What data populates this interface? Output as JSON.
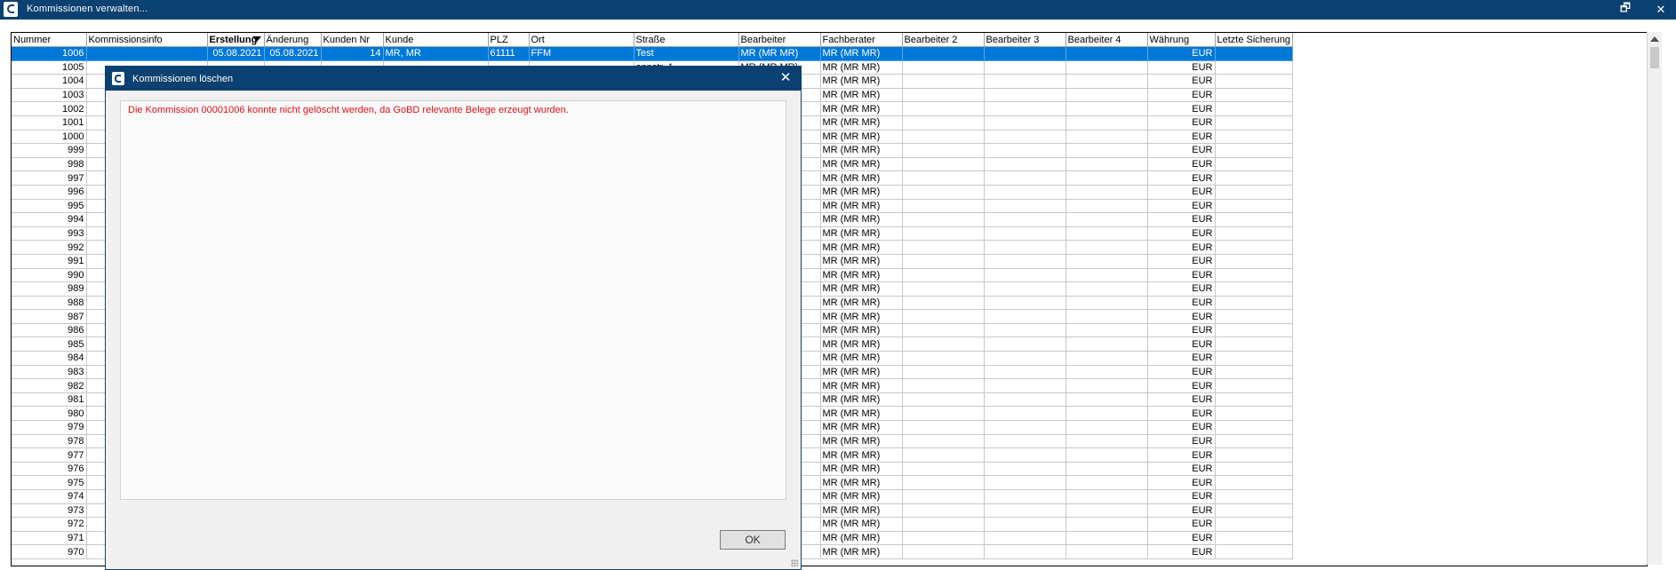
{
  "window": {
    "title": "Kommissionen verwalten...",
    "restore_glyph": "🗗",
    "close_glyph": "✕"
  },
  "grid": {
    "columns": [
      {
        "key": "nummer",
        "label": "Nummer",
        "width": 100,
        "align": "r"
      },
      {
        "key": "info",
        "label": "Kommissionsinfo",
        "width": 170,
        "align": ""
      },
      {
        "key": "erstellung",
        "label": "Erstellung",
        "width": 76,
        "align": "r",
        "sorted": true
      },
      {
        "key": "aenderung",
        "label": "Änderung",
        "width": 76,
        "align": "r"
      },
      {
        "key": "kundennr",
        "label": "Kunden Nr",
        "width": 85,
        "align": "r"
      },
      {
        "key": "kunde",
        "label": "Kunde",
        "width": 142,
        "align": ""
      },
      {
        "key": "plz",
        "label": "PLZ",
        "width": 55,
        "align": ""
      },
      {
        "key": "ort",
        "label": "Ort",
        "width": 143,
        "align": ""
      },
      {
        "key": "strasse",
        "label": "Straße",
        "width": 143,
        "align": ""
      },
      {
        "key": "bearbeiter",
        "label": "Bearbeiter",
        "width": 112,
        "align": ""
      },
      {
        "key": "fachberater",
        "label": "Fachberater",
        "width": 112,
        "align": ""
      },
      {
        "key": "bearbeiter2",
        "label": "Bearbeiter 2",
        "width": 112,
        "align": ""
      },
      {
        "key": "bearbeiter3",
        "label": "Bearbeiter 3",
        "width": 112,
        "align": ""
      },
      {
        "key": "bearbeiter4",
        "label": "Bearbeiter 4",
        "width": 112,
        "align": ""
      },
      {
        "key": "waehrung",
        "label": "Währung",
        "width": 92,
        "align": "r"
      },
      {
        "key": "sicherung",
        "label": "Letzte Sicherung",
        "width": 100,
        "align": ""
      }
    ],
    "rows": [
      {
        "nummer": "1006",
        "info": "",
        "erstellung": "05.08.2021",
        "aenderung": "05.08.2021",
        "kundennr": "14",
        "kunde": "MR, MR",
        "plz": "61111",
        "ort": "FFM",
        "strasse": "Test",
        "bearbeiter": "MR (MR MR)",
        "fachberater": "MR (MR MR)",
        "bearbeiter2": "",
        "bearbeiter3": "",
        "bearbeiter4": "",
        "waehrung": "EUR",
        "sicherung": "",
        "selected": true
      },
      {
        "nummer": "1005",
        "strasse": "annstr. 1",
        "bearbeiter": "MR (MR MR)",
        "fachberater": "MR (MR MR)",
        "waehrung": "EUR"
      },
      {
        "nummer": "1004",
        "bearbeiter": "MR (MR MR)",
        "fachberater": "MR (MR MR)",
        "waehrung": "EUR"
      },
      {
        "nummer": "1003",
        "bearbeiter": "MR (MR MR)",
        "fachberater": "MR (MR MR)",
        "waehrung": "EUR"
      },
      {
        "nummer": "1002",
        "bearbeiter": "MR (MR MR)",
        "fachberater": "MR (MR MR)",
        "waehrung": "EUR"
      },
      {
        "nummer": "1001",
        "bearbeiter": "MR (MR MR)",
        "fachberater": "MR (MR MR)",
        "waehrung": "EUR"
      },
      {
        "nummer": "1000",
        "bearbeiter": "MR (MR MR)",
        "fachberater": "MR (MR MR)",
        "waehrung": "EUR"
      },
      {
        "nummer": "999",
        "bearbeiter": "MR (MR MR)",
        "fachberater": "MR (MR MR)",
        "waehrung": "EUR"
      },
      {
        "nummer": "998",
        "bearbeiter": "MR (MR MR)",
        "fachberater": "MR (MR MR)",
        "waehrung": "EUR"
      },
      {
        "nummer": "997",
        "bearbeiter": "MR (MR MR)",
        "fachberater": "MR (MR MR)",
        "waehrung": "EUR"
      },
      {
        "nummer": "996",
        "bearbeiter": "MR (MR MR)",
        "fachberater": "MR (MR MR)",
        "waehrung": "EUR"
      },
      {
        "nummer": "995",
        "bearbeiter": "MR (MR MR)",
        "fachberater": "MR (MR MR)",
        "waehrung": "EUR"
      },
      {
        "nummer": "994",
        "bearbeiter": "MR (MR MR)",
        "fachberater": "MR (MR MR)",
        "waehrung": "EUR"
      },
      {
        "nummer": "993",
        "bearbeiter": "MR (MR MR)",
        "fachberater": "MR (MR MR)",
        "waehrung": "EUR"
      },
      {
        "nummer": "992",
        "bearbeiter": "MR (MR MR)",
        "fachberater": "MR (MR MR)",
        "waehrung": "EUR"
      },
      {
        "nummer": "991",
        "bearbeiter": "MR (MR MR)",
        "fachberater": "MR (MR MR)",
        "waehrung": "EUR"
      },
      {
        "nummer": "990",
        "bearbeiter": "MR (MR MR)",
        "fachberater": "MR (MR MR)",
        "waehrung": "EUR"
      },
      {
        "nummer": "989",
        "bearbeiter": "MR (MR MR)",
        "fachberater": "MR (MR MR)",
        "waehrung": "EUR"
      },
      {
        "nummer": "988",
        "bearbeiter": "MR (MR MR)",
        "fachberater": "MR (MR MR)",
        "waehrung": "EUR"
      },
      {
        "nummer": "987",
        "bearbeiter": "MR (MR MR)",
        "fachberater": "MR (MR MR)",
        "waehrung": "EUR"
      },
      {
        "nummer": "986",
        "bearbeiter": "MR (MR MR)",
        "fachberater": "MR (MR MR)",
        "waehrung": "EUR"
      },
      {
        "nummer": "985",
        "bearbeiter": "MR (MR MR)",
        "fachberater": "MR (MR MR)",
        "waehrung": "EUR"
      },
      {
        "nummer": "984",
        "bearbeiter": "MR (MR MR)",
        "fachberater": "MR (MR MR)",
        "waehrung": "EUR"
      },
      {
        "nummer": "983",
        "bearbeiter": "MR (MR MR)",
        "fachberater": "MR (MR MR)",
        "waehrung": "EUR"
      },
      {
        "nummer": "982",
        "bearbeiter": "MR (MR MR)",
        "fachberater": "MR (MR MR)",
        "waehrung": "EUR"
      },
      {
        "nummer": "981",
        "bearbeiter": "MR (MR MR)",
        "fachberater": "MR (MR MR)",
        "waehrung": "EUR"
      },
      {
        "nummer": "980",
        "bearbeiter": "MR (MR MR)",
        "fachberater": "MR (MR MR)",
        "waehrung": "EUR"
      },
      {
        "nummer": "979",
        "bearbeiter": "MR (MR MR)",
        "fachberater": "MR (MR MR)",
        "waehrung": "EUR"
      },
      {
        "nummer": "978",
        "bearbeiter": "MR (MR MR)",
        "fachberater": "MR (MR MR)",
        "waehrung": "EUR"
      },
      {
        "nummer": "977",
        "bearbeiter": "MR (MR MR)",
        "fachberater": "MR (MR MR)",
        "waehrung": "EUR"
      },
      {
        "nummer": "976",
        "bearbeiter": "MR (MR MR)",
        "fachberater": "MR (MR MR)",
        "waehrung": "EUR"
      },
      {
        "nummer": "975",
        "bearbeiter": "MR (MR MR)",
        "fachberater": "MR (MR MR)",
        "waehrung": "EUR"
      },
      {
        "nummer": "974",
        "bearbeiter": "MR (MR MR)",
        "fachberater": "MR (MR MR)",
        "waehrung": "EUR"
      },
      {
        "nummer": "973",
        "bearbeiter": "MR (MR MR)",
        "fachberater": "MR (MR MR)",
        "waehrung": "EUR"
      },
      {
        "nummer": "972",
        "bearbeiter": "MR (MR MR)",
        "fachberater": "MR (MR MR)",
        "waehrung": "EUR"
      },
      {
        "nummer": "971",
        "bearbeiter": "MR (MR MR)",
        "fachberater": "MR (MR MR)",
        "waehrung": "EUR"
      },
      {
        "nummer": "970",
        "bearbeiter": "MR (MR MR)",
        "fachberater": "MR (MR MR)",
        "waehrung": "EUR"
      }
    ]
  },
  "dialog": {
    "title": "Kommissionen löschen",
    "close_glyph": "✕",
    "message": "Die Kommission 00001006 konnte nicht gelöscht werden, da GoBD relevante Belege erzeugt wurden.",
    "ok_label": "OK"
  },
  "colors": {
    "titlebar": "#0b4170",
    "selection": "#0078d7",
    "error_text": "#e0101a"
  }
}
